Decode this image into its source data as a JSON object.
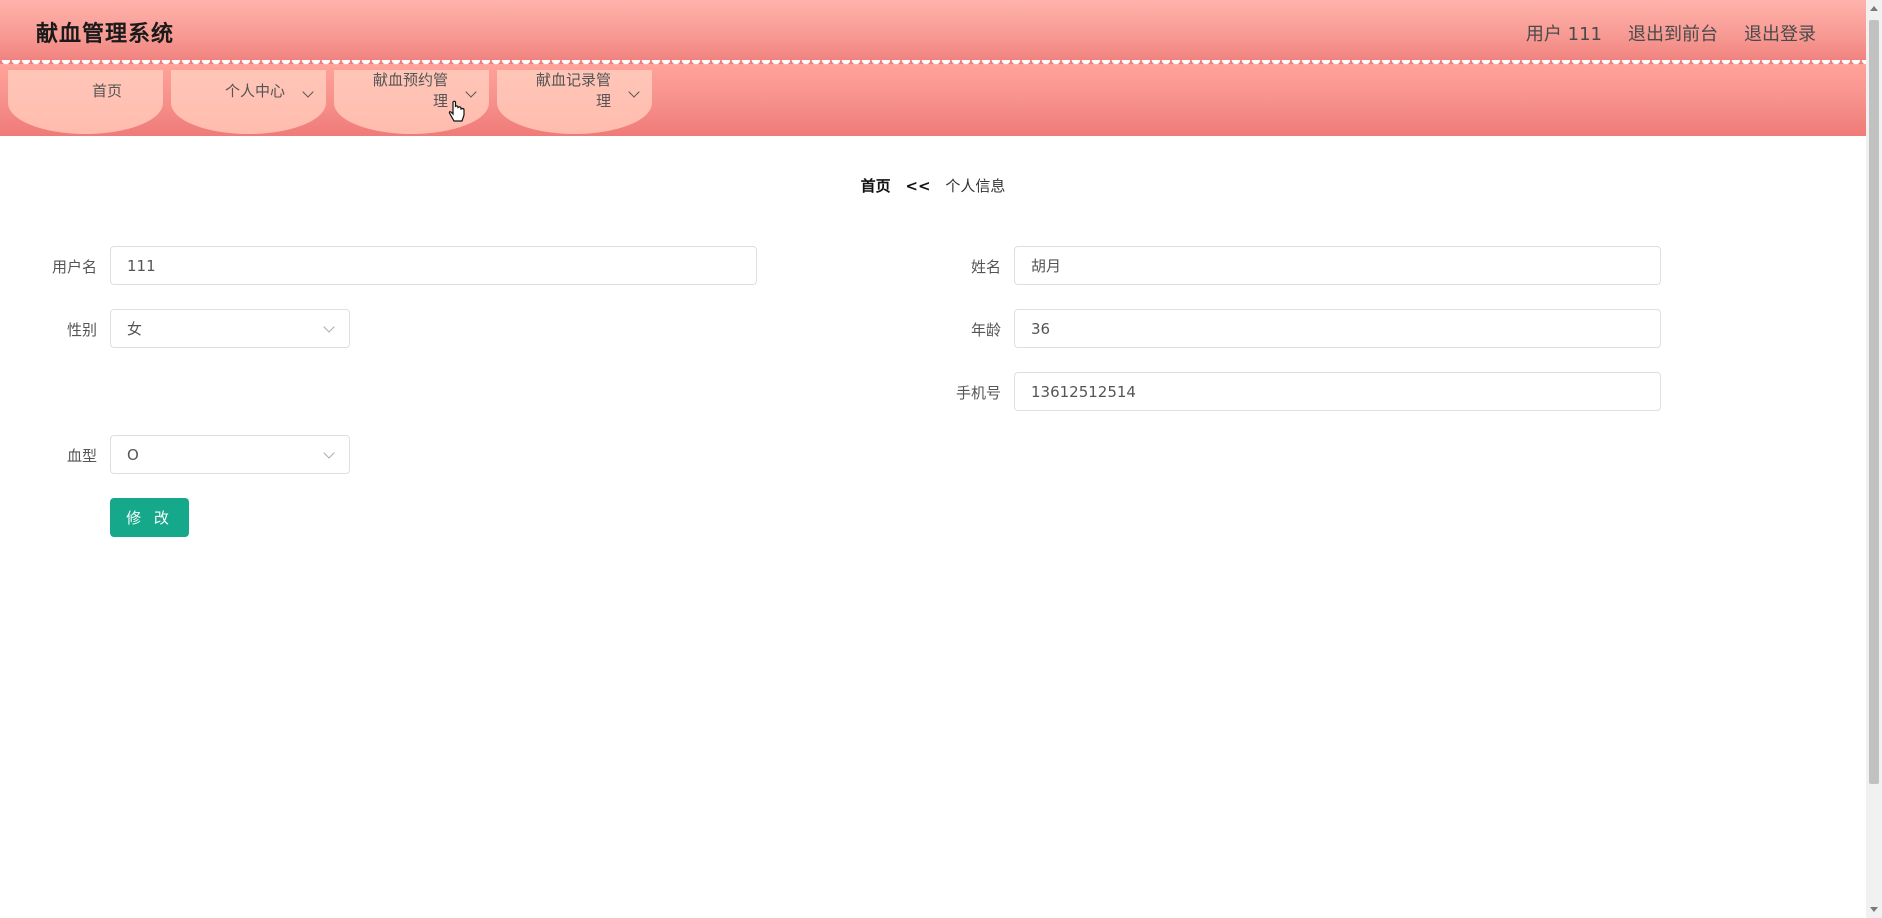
{
  "app": {
    "title": "献血管理系统"
  },
  "header": {
    "user_label": "用户 111",
    "exit_front": "退出到前台",
    "logout": "退出登录"
  },
  "nav": {
    "items": [
      {
        "label": "首页"
      },
      {
        "label": "个人中心"
      },
      {
        "label": "献血预约管理"
      },
      {
        "label": "献血记录管理"
      }
    ]
  },
  "breadcrumb": {
    "home": "首页",
    "sep": "<<",
    "current": "个人信息"
  },
  "form": {
    "username": {
      "label": "用户名",
      "value": "111"
    },
    "name": {
      "label": "姓名",
      "value": "胡月"
    },
    "gender": {
      "label": "性别",
      "value": "女"
    },
    "age": {
      "label": "年龄",
      "value": "36"
    },
    "phone": {
      "label": "手机号",
      "value": "13612512514"
    },
    "blood_type": {
      "label": "血型",
      "value": "O"
    },
    "submit": "修 改"
  },
  "colors": {
    "header_top": "#ffb3ab",
    "header_bottom": "#f07f7c",
    "nav_tab": "#ffc6b8",
    "button": "#16a88a"
  }
}
